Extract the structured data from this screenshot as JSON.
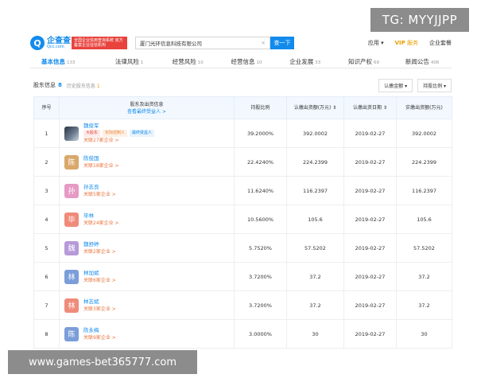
{
  "watermark": {
    "top": "TG: MYYJJPP",
    "bottom": "www.games-bet365777.com"
  },
  "header": {
    "logo_glyph": "Q",
    "logo_main": "企查查",
    "logo_sub": "Qcc.com",
    "badge": "全国企业信用查询系统 官方备案企业征信机构",
    "search_value": "厦门光环信息科技有限公司",
    "search_clear": "×",
    "search_button": "查一下",
    "nav": {
      "app": "应用",
      "vip_prefix": "VIP",
      "vip_label": "服务",
      "enterprise": "企业套餐"
    }
  },
  "tabs": [
    {
      "label": "基本信息",
      "count": "133"
    },
    {
      "label": "法律风险",
      "count": "1"
    },
    {
      "label": "经营风险",
      "count": "10"
    },
    {
      "label": "经营信息",
      "count": "10"
    },
    {
      "label": "企业发展",
      "count": "33"
    },
    {
      "label": "知识产权",
      "count": "69"
    },
    {
      "label": "新闻公告",
      "count": "406"
    }
  ],
  "section": {
    "title": "股东信息",
    "count": "8",
    "history_label": "历史股东信息",
    "history_count": "1",
    "dropdown1": "认缴金额 ▾",
    "dropdown2": "持股比例 ▾"
  },
  "table": {
    "headers": {
      "no": "序号",
      "holder": "股东及出资信息",
      "holder_link": "查看最终受益人 >",
      "ratio": "持股比例",
      "amount": "认缴出资额(万元) ⇕",
      "date": "认缴出资日期 ⇕",
      "paid": "实缴出资额(万元)"
    },
    "rows": [
      {
        "no": "1",
        "avatar": "",
        "avatar_color": "photo",
        "name": "魏俊军",
        "tags": [
          "大股东",
          "实际控制人",
          "最终受益人"
        ],
        "related": "关联27家企业 >",
        "ratio": "39.2000%",
        "amount": "392.0002",
        "date": "2019-02-27",
        "paid": "392.0002"
      },
      {
        "no": "2",
        "avatar": "陈",
        "avatar_color": "#d9a86b",
        "name": "陈俊国",
        "tags": [],
        "related": "关联18家企业 >",
        "ratio": "22.4240%",
        "amount": "224.2399",
        "date": "2019-02-27",
        "paid": "224.2399"
      },
      {
        "no": "3",
        "avatar": "孙",
        "avatar_color": "#e69ac4",
        "name": "孙志良",
        "tags": [],
        "related": "关联5家企业 >",
        "ratio": "11.6240%",
        "amount": "116.2397",
        "date": "2019-02-27",
        "paid": "116.2397"
      },
      {
        "no": "4",
        "avatar": "毕",
        "avatar_color": "#ef8b7b",
        "name": "毕林",
        "tags": [],
        "related": "关联24家企业 >",
        "ratio": "10.5600%",
        "amount": "105.6",
        "date": "2019-02-27",
        "paid": "105.6"
      },
      {
        "no": "5",
        "avatar": "魏",
        "avatar_color": "#b79ad9",
        "name": "魏舒婷",
        "tags": [],
        "related": "关联2家企业 >",
        "ratio": "5.7520%",
        "amount": "57.5202",
        "date": "2019-02-27",
        "paid": "57.5202"
      },
      {
        "no": "6",
        "avatar": "林",
        "avatar_color": "#7b9ed9",
        "name": "林加斌",
        "tags": [],
        "related": "关联6家企业 >",
        "ratio": "3.7200%",
        "amount": "37.2",
        "date": "2019-02-27",
        "paid": "37.2"
      },
      {
        "no": "7",
        "avatar": "林",
        "avatar_color": "#ef8b7b",
        "name": "林志斌",
        "tags": [],
        "related": "关联3家企业 >",
        "ratio": "3.7200%",
        "amount": "37.2",
        "date": "2019-02-27",
        "paid": "37.2"
      },
      {
        "no": "8",
        "avatar": "陈",
        "avatar_color": "#7b9ed9",
        "name": "陈永梅",
        "tags": [],
        "related": "关联9家企业 >",
        "ratio": "3.0000%",
        "amount": "30",
        "date": "2019-02-27",
        "paid": "30"
      }
    ]
  },
  "colors": {
    "brand": "#128bed",
    "badge": "#e8433d",
    "link": "#128bed",
    "related": "#e8743d"
  }
}
